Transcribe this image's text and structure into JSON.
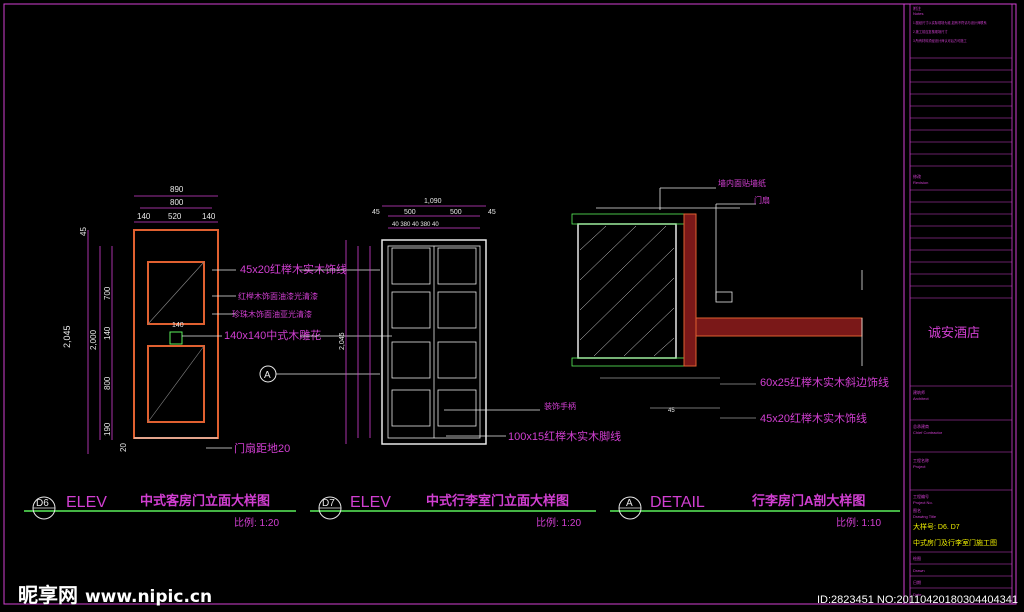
{
  "drawings": {
    "d6": {
      "code": "D6",
      "type": "ELEV",
      "title": "中式客房门立面大样图",
      "scale": "比例: 1:20"
    },
    "d7": {
      "code": "D7",
      "type": "ELEV",
      "title": "中式行李室门立面大样图",
      "scale": "比例: 1:20"
    },
    "a": {
      "code": "A",
      "type": "DETAIL",
      "title": "行李房门A剖大样图",
      "scale": "比例: 1:10"
    }
  },
  "d6_dims": {
    "total_w": "890",
    "inner_w": "800",
    "seg_l": "140",
    "seg_m": "520",
    "seg_r": "140",
    "top": "45",
    "h1": "700",
    "h_mid": "140",
    "h2": "800",
    "bot1": "190",
    "bot2": "20",
    "total_h": "2,045",
    "h_total2": "2,000",
    "mid_label": "140"
  },
  "d7_dims": {
    "total_w": "1,090",
    "seg1": "500",
    "seg2": "500",
    "left": "45",
    "right": "45",
    "sub": "40 380 40 380 40",
    "h_total": "2,045"
  },
  "annotations": {
    "moulding_45x20": "45x20红榉木实木饰线",
    "panel_paint": "红榉木饰面油漆光清漆",
    "sapele_panel": "珍珠木饰面油亚光清漆",
    "flower_140": "140x140中式木雕花",
    "door_gap": "门扇距地20",
    "handle": "装饰手柄",
    "skirting_100x15": "100x15红榉木实木脚线",
    "wall_paper": "墙内面贴墙纸",
    "door_leaf": "门扇",
    "edge_60x25": "60x25红榉木实木斜边饰线",
    "moulding_45x20b": "45x20红榉木实木饰线",
    "dim_45": "45"
  },
  "title_block": {
    "notes_label": "附注",
    "notes_en": "Notes",
    "note_lines": [
      "1.图纸尺寸以实际现场为准,如有不符请与设计师联系",
      "2.施工前应复核现场尺寸",
      "3.所有材料须经设计师认可后方可施工"
    ],
    "revision_label": "修改",
    "revision_en": "Revision",
    "hotel": "诚安酒店",
    "architect_label": "建筑师",
    "architect_en": "Architect",
    "contractor_label": "总承建商",
    "contractor_en": "Chief Contractor",
    "project_label": "工程名称",
    "project_en": "Project",
    "projno_label": "工程编号",
    "projno_en": "Project No.",
    "drawing_title_label": "图名",
    "drawing_title_en": "Drawing Title",
    "sheet_no": "大样号: D6. D7",
    "sheet_title": "中式房门及行李室门施工图",
    "drawn_label": "绘图",
    "drawn_en": "Drawn",
    "date_label": "日期",
    "date_en": "Date"
  },
  "watermark": {
    "brand": "昵享网",
    "url": "www.nipic.cn",
    "id": "ID:2823451 NO:20110420180304404341"
  }
}
